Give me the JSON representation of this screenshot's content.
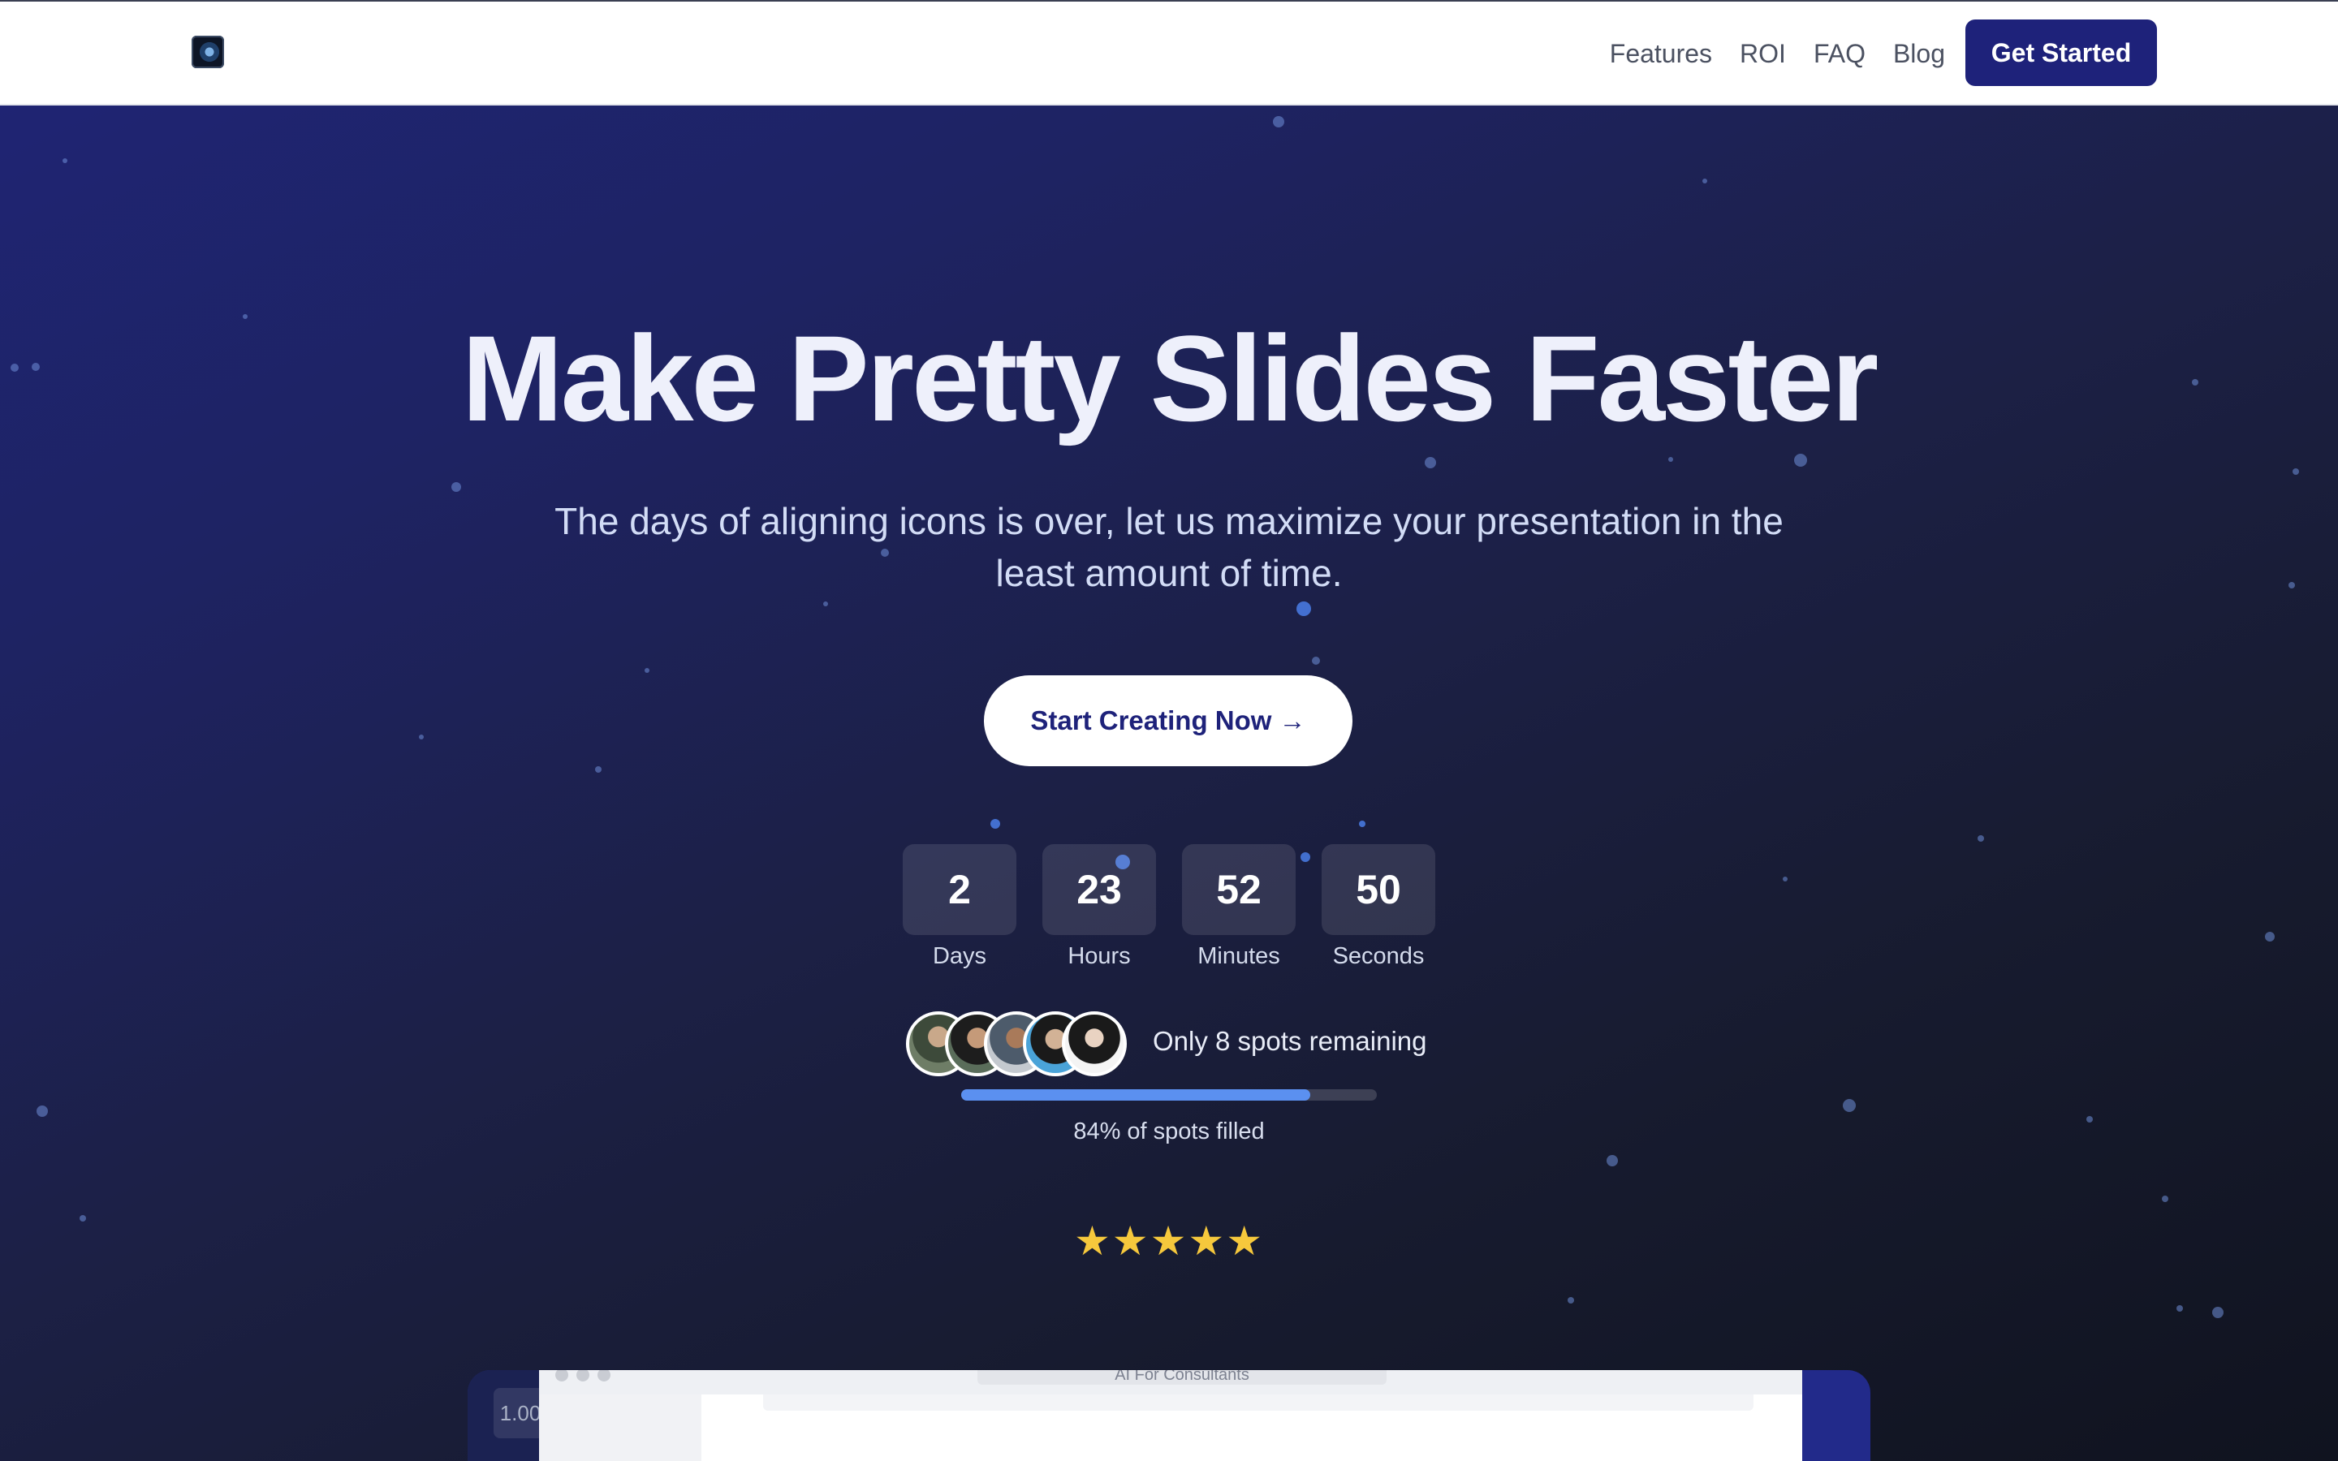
{
  "nav": {
    "logo_icon": "camera-lens-logo",
    "links": [
      "Features",
      "ROI",
      "FAQ",
      "Blog"
    ],
    "cta_label": "Get Started"
  },
  "hero": {
    "headline": "Make Pretty Slides Faster",
    "subheadline": "The days of aligning icons is over, let us maximize your presentation in the least amount of time.",
    "cta_label": "Start Creating Now →"
  },
  "countdown": {
    "days": "2",
    "days_label": "Days",
    "hours": "23",
    "hours_label": "Hours",
    "minutes": "52",
    "minutes_label": "Minutes",
    "seconds": "50",
    "seconds_label": "Seconds"
  },
  "social_proof": {
    "avatar_count": 5,
    "spots_text": "Only 8 spots remaining",
    "progress_percent": 84,
    "progress_caption": "84% of spots filled",
    "rating_stars": 5,
    "stars": "★★★★★"
  },
  "preview": {
    "zoom": "1.00",
    "window_title": "AI For Consultants"
  },
  "colors": {
    "brand_navy": "#1e227a",
    "hero_bg_start": "#1f2473",
    "hero_bg_end": "#10131f",
    "progress_fill": "#5b90f0",
    "star_color": "#f6c83c"
  }
}
